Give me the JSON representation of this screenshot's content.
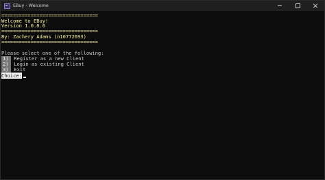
{
  "window": {
    "title": "EBuy - Welcome",
    "icon": "console-app-icon"
  },
  "console": {
    "separator1": "=================================",
    "welcome": "Welcome to EBuy!",
    "version": "Version 1.0.0.0",
    "separator2": "=================================",
    "author": "By: Zachery Adams (n10772693)",
    "separator3": "=================================",
    "prompt": "Please select one of the following:",
    "options": [
      {
        "num": "1)",
        "label": " Register as a new Client"
      },
      {
        "num": "2)",
        "label": " Login as existing Client"
      },
      {
        "num": "3)",
        "label": " Exit"
      }
    ],
    "choice_label": "Choice:",
    "input_value": ""
  },
  "colors": {
    "background": "#0c0c0c",
    "banner_text": "#f9f1a5",
    "body_text": "#cccccc",
    "highlight_bg": "#767676",
    "choice_bg": "#f2f2f2"
  }
}
